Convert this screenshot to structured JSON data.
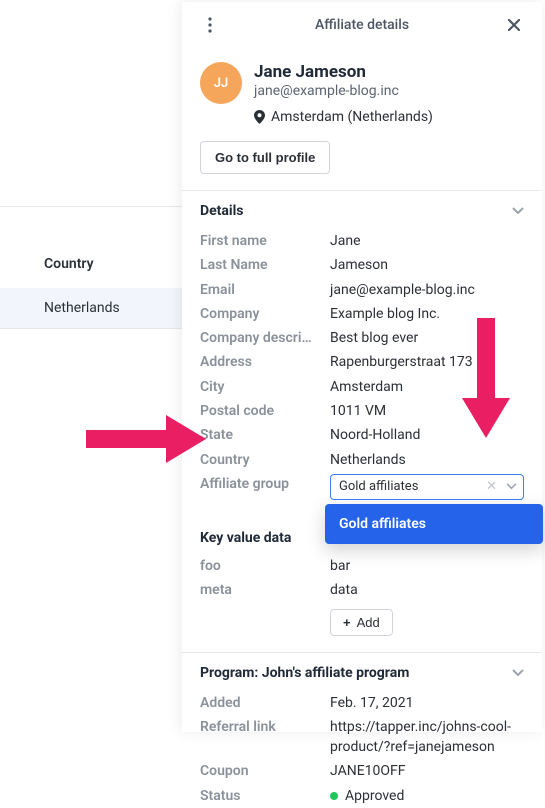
{
  "bg": {
    "column_header": "Country",
    "row_value": "Netherlands"
  },
  "header": {
    "title": "Affiliate details"
  },
  "profile": {
    "initials": "JJ",
    "name": "Jane Jameson",
    "email": "jane@example-blog.inc",
    "location": "Amsterdam (Netherlands)",
    "go_to_profile": "Go to full profile"
  },
  "details": {
    "title": "Details",
    "fields": {
      "first_name_label": "First name",
      "first_name_value": "Jane",
      "last_name_label": "Last Name",
      "last_name_value": "Jameson",
      "email_label": "Email",
      "email_value": "jane@example-blog.inc",
      "company_label": "Company",
      "company_value": "Example blog Inc.",
      "company_desc_label": "Company descri…",
      "company_desc_value": "Best blog ever",
      "address_label": "Address",
      "address_value": "Rapenburgerstraat 173",
      "city_label": "City",
      "city_value": "Amsterdam",
      "postal_label": "Postal code",
      "postal_value": "1011 VM",
      "state_label": "State",
      "state_value": "Noord-Holland",
      "country_label": "Country",
      "country_value": "Netherlands",
      "group_label": "Affiliate group",
      "group_value": "Gold affiliates"
    },
    "dropdown_option": "Gold affiliates"
  },
  "kvdata": {
    "title": "Key value data",
    "row1_key": "foo",
    "row1_val": "bar",
    "row2_key": "meta",
    "row2_val": "data",
    "add_label": "Add"
  },
  "program": {
    "title": "Program: John's affiliate program",
    "added_label": "Added",
    "added_value": "Feb. 17, 2021",
    "referral_label": "Referral link",
    "referral_value": "https://tapper.inc/johns-cool-product/?ref=janejameson",
    "coupon_label": "Coupon",
    "coupon_value": "JANE10OFF",
    "status_label": "Status",
    "status_value": "Approved"
  }
}
